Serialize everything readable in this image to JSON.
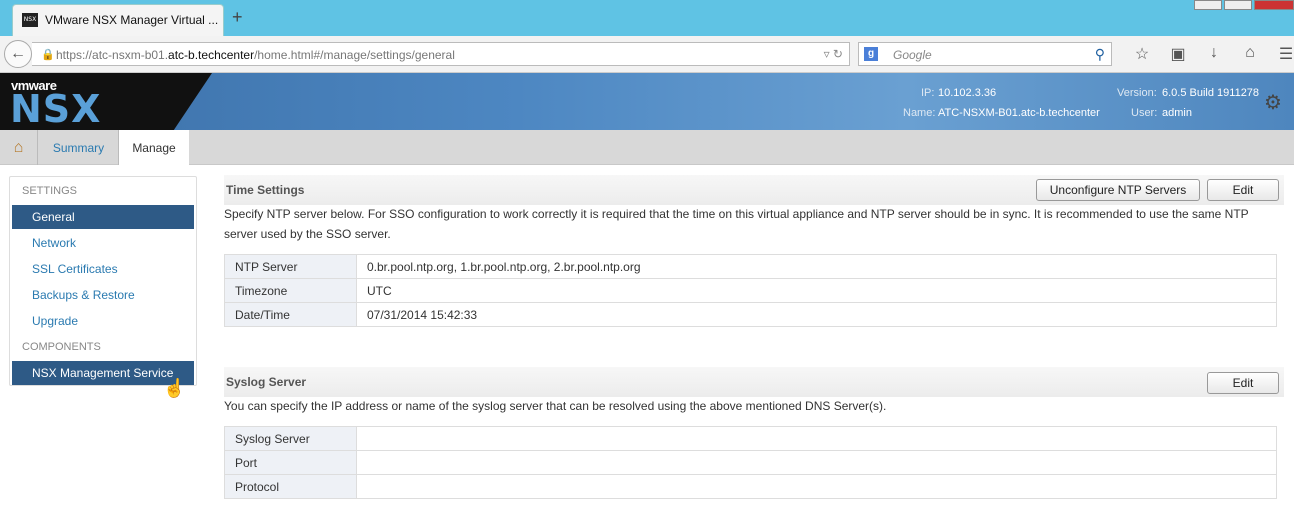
{
  "browser": {
    "tab_title": "VMware NSX Manager Virtual ...",
    "favicon_text": "NSX",
    "url_prefix": "https://atc-nsxm-b01.",
    "url_domain": "atc-b.techcenter",
    "url_path": "/home.html#/manage/settings/general",
    "search_placeholder": "Google",
    "icons": [
      "back-arrow-icon",
      "lock-icon",
      "bookmark-star-icon",
      "reading-list-icon",
      "download-icon",
      "home-icon",
      "menu-icon"
    ]
  },
  "header": {
    "vmware_text": "vmware",
    "product": "NSX",
    "ip_label": "IP:",
    "ip_value": "10.102.3.36",
    "name_label": "Name:",
    "name_value": "ATC-NSXM-B01.atc-b.techcenter",
    "version_label": "Version:",
    "version_value": "6.0.5 Build 1911278",
    "user_label": "User:",
    "user_value": "admin"
  },
  "tabs": {
    "summary": "Summary",
    "manage": "Manage"
  },
  "sidebar": {
    "settings_heading": "SETTINGS",
    "items": [
      {
        "label": "General",
        "active": true
      },
      {
        "label": "Network",
        "active": false
      },
      {
        "label": "SSL Certificates",
        "active": false
      },
      {
        "label": "Backups & Restore",
        "active": false
      },
      {
        "label": "Upgrade",
        "active": false
      }
    ],
    "components_heading": "COMPONENTS",
    "components": [
      {
        "label": "NSX Management Service",
        "active": true
      }
    ]
  },
  "time_settings": {
    "title": "Time Settings",
    "unconfigure_label": "Unconfigure NTP Servers",
    "edit_label": "Edit",
    "description": "Specify NTP server below. For SSO configuration to work correctly it is required that the time on this virtual appliance and NTP server should be in sync. It is recommended to use the same NTP server used by the SSO server.",
    "rows": [
      {
        "key": "NTP Server",
        "value": "0.br.pool.ntp.org, 1.br.pool.ntp.org, 2.br.pool.ntp.org"
      },
      {
        "key": "Timezone",
        "value": "UTC"
      },
      {
        "key": "Date/Time",
        "value": "07/31/2014 15:42:33"
      }
    ]
  },
  "syslog": {
    "title": "Syslog Server",
    "edit_label": "Edit",
    "description": "You can specify the IP address or name of the syslog server that can be resolved using the above mentioned DNS Server(s).",
    "rows": [
      {
        "key": "Syslog Server",
        "value": ""
      },
      {
        "key": "Port",
        "value": ""
      },
      {
        "key": "Protocol",
        "value": ""
      }
    ]
  },
  "colors": {
    "accent": "#2e5a86",
    "link": "#2a7ab0",
    "titlebar": "#5fc3e4"
  }
}
